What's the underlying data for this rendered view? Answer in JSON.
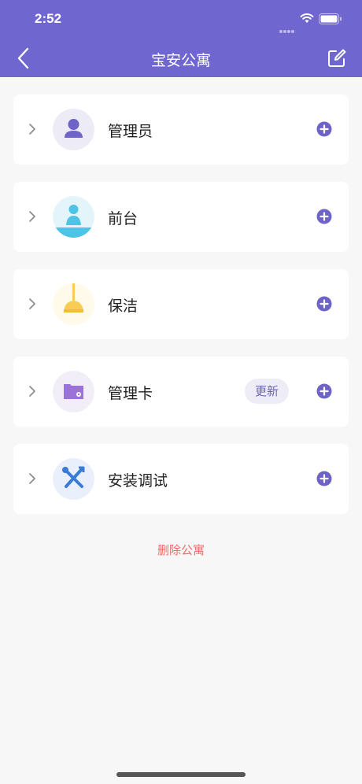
{
  "status_bar": {
    "time": "2:52"
  },
  "nav": {
    "title": "宝安公寓"
  },
  "roles": [
    {
      "label": "管理员"
    },
    {
      "label": "前台"
    },
    {
      "label": "保洁"
    },
    {
      "label": "管理卡",
      "badge": "更新"
    },
    {
      "label": "安装调试"
    }
  ],
  "footer": {
    "delete_label": "删除公寓"
  },
  "colors": {
    "primary": "#6f66cf",
    "danger": "#ef6b6b",
    "background": "#f7f7f7"
  }
}
